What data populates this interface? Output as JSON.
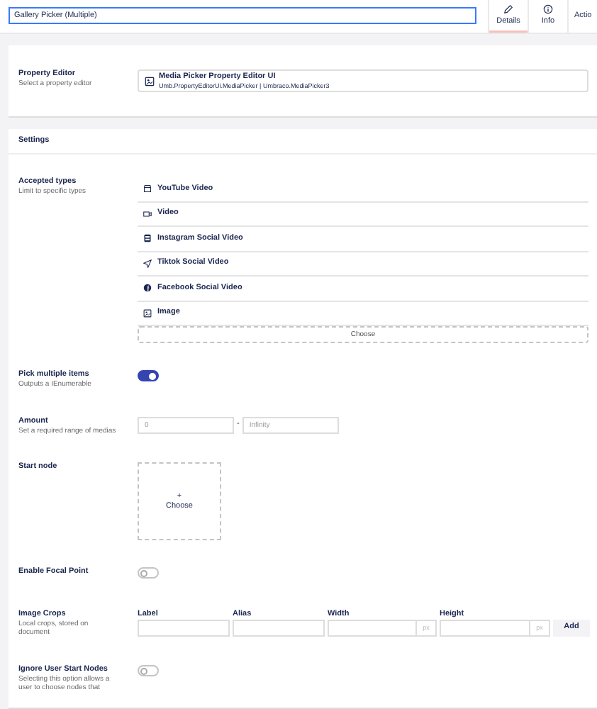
{
  "name_field": {
    "value": "Gallery Picker (Multiple)"
  },
  "tabs": [
    {
      "label": "Details",
      "selected": true
    },
    {
      "label": "Info",
      "selected": false
    },
    {
      "label": "Actio",
      "selected": false
    }
  ],
  "property_editor": {
    "label": "Property Editor",
    "description": "Select a property editor",
    "name": "Media Picker Property Editor UI",
    "alias": "Umb.PropertyEditorUi.MediaPicker | Umbraco.MediaPicker3"
  },
  "settings": {
    "title": "Settings",
    "properties": [
      {
        "kind": "types",
        "label": "Accepted types",
        "description": "Limit to specific types",
        "items": [
          {
            "label": "YouTube Video"
          },
          {
            "label": "Video"
          },
          {
            "label": "Instagram Social Video"
          },
          {
            "label": "Tiktok Social Video"
          },
          {
            "label": "Facebook Social Video"
          },
          {
            "label": "Image"
          }
        ],
        "button": "Choose"
      },
      {
        "kind": "toggle",
        "label": "Pick multiple items",
        "description": "Outputs a IEnumerable",
        "on": true
      },
      {
        "kind": "range",
        "label": "Amount",
        "description": "Set a required range of medias",
        "min": {
          "placeholder": "0"
        },
        "separator": "-",
        "max": {
          "placeholder": "Infinity"
        }
      },
      {
        "kind": "start_node",
        "label": "Start node",
        "plus": "+",
        "button": "Choose"
      },
      {
        "kind": "toggle",
        "label": "Enable Focal Point",
        "on": false
      },
      {
        "kind": "crops",
        "label": "Image Crops",
        "description": "Local crops, stored on document",
        "columns": [
          {
            "label": "Label"
          },
          {
            "label": "Alias"
          },
          {
            "label": "Width",
            "unit": "px"
          },
          {
            "label": "Height",
            "unit": "px"
          }
        ],
        "button": "Add"
      },
      {
        "kind": "toggle",
        "label": "Ignore User Start Nodes",
        "description": "Selecting this option allows a user to choose nodes that",
        "on": false
      }
    ]
  }
}
